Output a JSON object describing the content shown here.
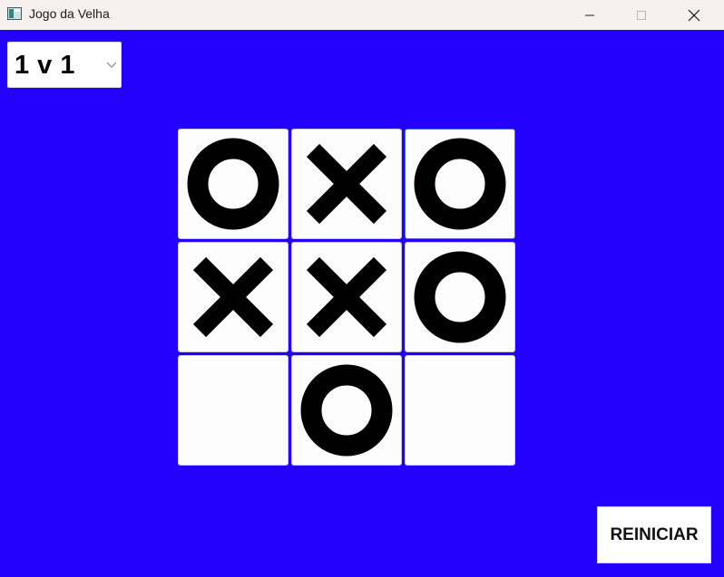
{
  "window": {
    "title": "Jogo da Velha",
    "icon": "app-window-icon",
    "controls": [
      "minimize-icon",
      "maximize-icon",
      "close-icon"
    ]
  },
  "colors": {
    "background": "#2300fe",
    "cell": "#fdfdfd",
    "mark": "#000000",
    "titlebar": "#f7f0ef"
  },
  "mode_select": {
    "value": "1 v 1",
    "icon": "chevron-down-icon"
  },
  "board": {
    "cells": [
      "O",
      "X",
      "O",
      "X",
      "X",
      "O",
      "",
      "O",
      ""
    ]
  },
  "restart_button": {
    "label": "REINICIAR"
  }
}
